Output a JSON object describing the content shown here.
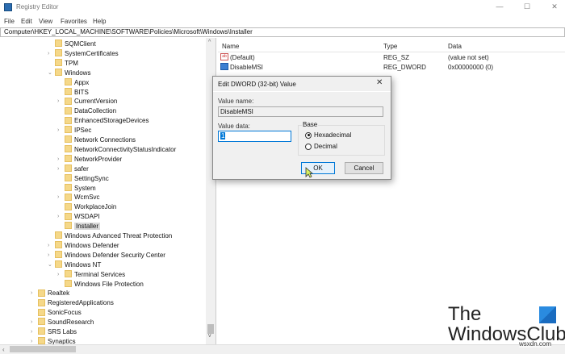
{
  "window": {
    "title": "Registry Editor",
    "minimize": "—",
    "maximize": "☐",
    "close": "✕"
  },
  "menu": [
    "File",
    "Edit",
    "View",
    "Favorites",
    "Help"
  ],
  "address": "Computer\\HKEY_LOCAL_MACHINE\\SOFTWARE\\Policies\\Microsoft\\Windows\\Installer",
  "tree": [
    {
      "label": "SQMClient",
      "level": 3,
      "exp": ""
    },
    {
      "label": "SystemCertificates",
      "level": 3,
      "exp": ">"
    },
    {
      "label": "TPM",
      "level": 3,
      "exp": ""
    },
    {
      "label": "Windows",
      "level": 3,
      "exp": "v"
    },
    {
      "label": "Appx",
      "level": 4,
      "exp": ""
    },
    {
      "label": "BITS",
      "level": 4,
      "exp": ""
    },
    {
      "label": "CurrentVersion",
      "level": 4,
      "exp": ">"
    },
    {
      "label": "DataCollection",
      "level": 4,
      "exp": ""
    },
    {
      "label": "EnhancedStorageDevices",
      "level": 4,
      "exp": ""
    },
    {
      "label": "IPSec",
      "level": 4,
      "exp": ">"
    },
    {
      "label": "Network Connections",
      "level": 4,
      "exp": ""
    },
    {
      "label": "NetworkConnectivityStatusIndicator",
      "level": 4,
      "exp": ""
    },
    {
      "label": "NetworkProvider",
      "level": 4,
      "exp": ">"
    },
    {
      "label": "safer",
      "level": 4,
      "exp": ">"
    },
    {
      "label": "SettingSync",
      "level": 4,
      "exp": ""
    },
    {
      "label": "System",
      "level": 4,
      "exp": ""
    },
    {
      "label": "WcmSvc",
      "level": 4,
      "exp": ">"
    },
    {
      "label": "WorkplaceJoin",
      "level": 4,
      "exp": ""
    },
    {
      "label": "WSDAPI",
      "level": 4,
      "exp": ">"
    },
    {
      "label": "Installer",
      "level": 4,
      "exp": "",
      "selected": true
    },
    {
      "label": "Windows Advanced Threat Protection",
      "level": 3,
      "exp": ""
    },
    {
      "label": "Windows Defender",
      "level": 3,
      "exp": ">"
    },
    {
      "label": "Windows Defender Security Center",
      "level": 3,
      "exp": ">"
    },
    {
      "label": "Windows NT",
      "level": 3,
      "exp": "v"
    },
    {
      "label": "Terminal Services",
      "level": 4,
      "exp": ">"
    },
    {
      "label": "Windows File Protection",
      "level": 4,
      "exp": ""
    },
    {
      "label": "Realtek",
      "level": 2,
      "exp": ">"
    },
    {
      "label": "RegisteredApplications",
      "level": 2,
      "exp": ""
    },
    {
      "label": "SonicFocus",
      "level": 2,
      "exp": ""
    },
    {
      "label": "SoundResearch",
      "level": 2,
      "exp": ">"
    },
    {
      "label": "SRS Labs",
      "level": 2,
      "exp": ">"
    },
    {
      "label": "Synaptics",
      "level": 2,
      "exp": ">"
    }
  ],
  "values": {
    "columns": [
      "Name",
      "Type",
      "Data"
    ],
    "rows": [
      {
        "icon": "string-value-icon",
        "name": "(Default)",
        "type": "REG_SZ",
        "data": "(value not set)"
      },
      {
        "icon": "dword-value-icon",
        "name": "DisableMSI",
        "type": "REG_DWORD",
        "data": "0x00000000 (0)"
      }
    ]
  },
  "dialog": {
    "title": "Edit DWORD (32-bit) Value",
    "close": "✕",
    "value_name_label": "Value name:",
    "value_name": "DisableMSI",
    "value_data_label": "Value data:",
    "value_data": "1",
    "base_label": "Base",
    "base_options": [
      "Hexadecimal",
      "Decimal"
    ],
    "base_selected": "Hexadecimal",
    "ok": "OK",
    "cancel": "Cancel"
  },
  "watermark": {
    "line1": "The",
    "line2": "WindowsClub",
    "site": "wsxdn.com"
  },
  "colors": {
    "folder": "#f5d889",
    "selection": "#d9d9d9",
    "accent": "#0078d7"
  }
}
